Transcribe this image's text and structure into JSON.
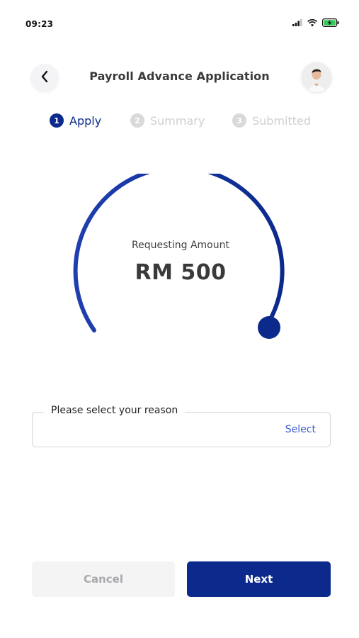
{
  "status_bar": {
    "time": "09:23",
    "icons": [
      "signal-icon",
      "wifi-icon",
      "battery-charging-icon"
    ]
  },
  "header": {
    "title": "Payroll Advance Application",
    "back_icon": "chevron-left-icon",
    "avatar": "user-avatar"
  },
  "stepper": {
    "steps": [
      {
        "number": "1",
        "label": "Apply",
        "state": "active"
      },
      {
        "number": "2",
        "label": "Summary",
        "state": "inactive"
      },
      {
        "number": "3",
        "label": "Submitted",
        "state": "inactive"
      }
    ]
  },
  "amount": {
    "label": "Requesting Amount",
    "value": "RM 500"
  },
  "reason": {
    "label": "Please select your reason",
    "action": "Select"
  },
  "actions": {
    "cancel_label": "Cancel",
    "next_label": "Next"
  },
  "colors": {
    "primary": "#0b2a8c",
    "link": "#3c5bd6",
    "disabled_text": "#a9a9ad",
    "disabled_bg": "#f4f4f5"
  }
}
